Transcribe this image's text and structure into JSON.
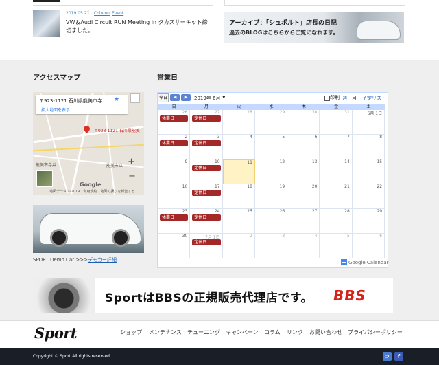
{
  "post": {
    "date": "2019.05.21",
    "separator": "|",
    "categories": [
      "Column",
      "Event"
    ],
    "title": "VW＆Audi Circuit RUN Meeting in タカスサーキット締切ました。"
  },
  "archive": {
    "line1": "アーカイブ：「シュポルト」店長の日記",
    "line2": "過去のBLOGはこちらからご覧になれます。"
  },
  "access": {
    "heading": "アクセスマップ",
    "map": {
      "address": "〒923-1121 石川県能美市寺...",
      "enlarge_link": "拡大地図を表示",
      "pin_label": "〒923-1121 石川県能美",
      "town1": "能美市寺井",
      "town2": "能美市立",
      "zoom_in": "+",
      "zoom_out": "−",
      "google": "Google",
      "footer": "地図データ ©2019　利用規約　地図の誤りを報告する"
    },
    "demo": {
      "caption_prefix": "SPORT Demo Car >>>",
      "caption_link": "デモカー詳細"
    }
  },
  "calendar": {
    "heading": "営業日",
    "today_button": "今日",
    "prev_button": "◀",
    "next_button": "▶",
    "month_label": "2019年 6月",
    "month_arrow": "▼",
    "print_label": "印刷",
    "view_week": "週",
    "view_month": "月",
    "view_agenda": "予定リスト",
    "weekdays": [
      "日",
      "月",
      "火",
      "水",
      "木",
      "金",
      "土"
    ],
    "weeks": [
      [
        {
          "d": "26",
          "o": true,
          "e": "休業日"
        },
        {
          "d": "27",
          "o": true,
          "e": "定休日"
        },
        {
          "d": "28",
          "o": true
        },
        {
          "d": "29",
          "o": true
        },
        {
          "d": "30",
          "o": true
        },
        {
          "d": "31",
          "o": true
        },
        {
          "d": "6月 1日"
        }
      ],
      [
        {
          "d": "2",
          "e": "休業日"
        },
        {
          "d": "3",
          "e": "定休日"
        },
        {
          "d": "4"
        },
        {
          "d": "5"
        },
        {
          "d": "6"
        },
        {
          "d": "7"
        },
        {
          "d": "8"
        }
      ],
      [
        {
          "d": "9"
        },
        {
          "d": "10",
          "e": "定休日"
        },
        {
          "d": "11",
          "t": true
        },
        {
          "d": "12"
        },
        {
          "d": "13"
        },
        {
          "d": "14"
        },
        {
          "d": "15"
        }
      ],
      [
        {
          "d": "16"
        },
        {
          "d": "17",
          "e": "定休日"
        },
        {
          "d": "18"
        },
        {
          "d": "19"
        },
        {
          "d": "20"
        },
        {
          "d": "21"
        },
        {
          "d": "22"
        }
      ],
      [
        {
          "d": "23",
          "e": "休業日"
        },
        {
          "d": "24",
          "e": "定休日"
        },
        {
          "d": "25"
        },
        {
          "d": "26"
        },
        {
          "d": "27"
        },
        {
          "d": "28"
        },
        {
          "d": "29"
        }
      ],
      [
        {
          "d": "30"
        },
        {
          "d": "7月 1日",
          "o": true,
          "e": "定休日"
        },
        {
          "d": "2",
          "o": true
        },
        {
          "d": "3",
          "o": true
        },
        {
          "d": "4",
          "o": true
        },
        {
          "d": "5",
          "o": true
        },
        {
          "d": "6",
          "o": true
        }
      ]
    ],
    "event_color": "#a32929",
    "google_plus": "+",
    "google_label": "Google Calendar"
  },
  "banner": {
    "text": "SportはBBSの正規販売代理店です。",
    "logo": "BBS"
  },
  "footer": {
    "logo": "Sport",
    "nav": [
      "ショップ",
      "メンテナンス",
      "チューニング",
      "キャンペーン",
      "コラム",
      "リンク",
      "お問い合わせ",
      "プライバシーポリシー"
    ],
    "copyright": "Copyright ©  Sport All rights reserved.",
    "social": [
      {
        "icon": "rss-icon",
        "glyph": "⊃"
      },
      {
        "icon": "facebook-icon",
        "glyph": "f"
      }
    ]
  }
}
